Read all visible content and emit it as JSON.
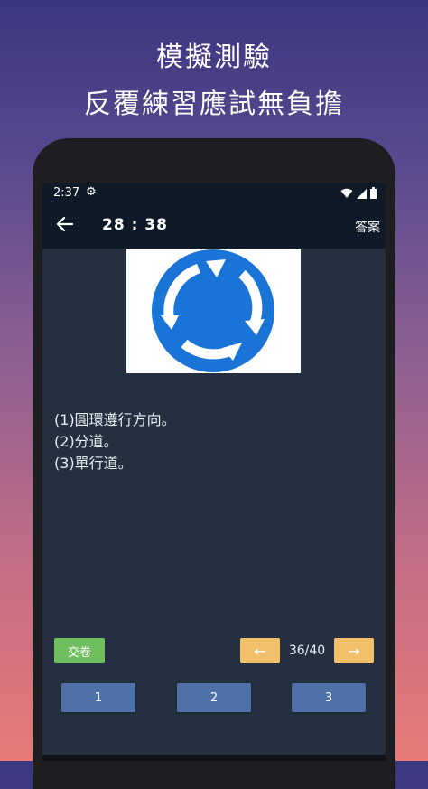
{
  "headline": {
    "line1": "模擬測驗",
    "line2": "反覆練習應試無負擔"
  },
  "status_bar": {
    "time": "2:37",
    "settings_icon": "gear-icon",
    "wifi_icon": "wifi-icon",
    "signal_icon": "signal-icon",
    "battery_icon": "battery-icon"
  },
  "app_bar": {
    "back_icon": "arrow-left-icon",
    "timer": "28 : 38",
    "answer_label": "答案"
  },
  "sign": {
    "icon": "roundabout-sign-icon",
    "color": "#1a73d6"
  },
  "question": {
    "options": [
      "(1)圓環遵行方向。",
      "(2)分道。",
      "(3)單行道。"
    ]
  },
  "controls": {
    "submit_label": "交卷",
    "prev_label": "←",
    "next_label": "→",
    "counter": "36/40",
    "answer_buttons": [
      "1",
      "2",
      "3"
    ]
  },
  "colors": {
    "submit": "#6fbf5e",
    "nav": "#f2c06b",
    "option": "#5071a8",
    "app_bar": "#0f1a28",
    "screen": "#24303f"
  }
}
